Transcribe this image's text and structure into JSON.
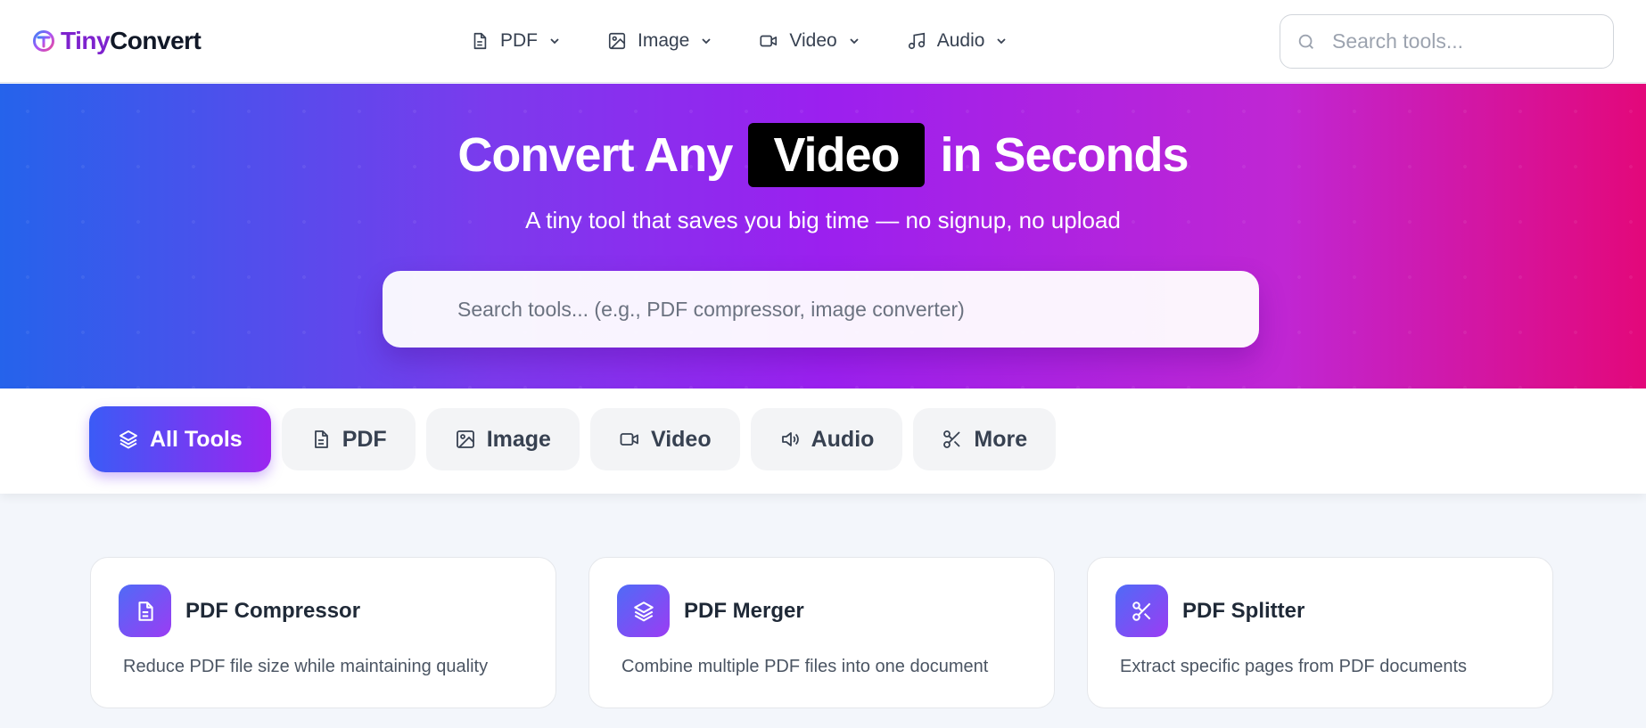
{
  "brand": {
    "name_part1": "Tiny",
    "name_part2": "Convert"
  },
  "nav": {
    "items": [
      {
        "label": "PDF",
        "icon": "file-icon"
      },
      {
        "label": "Image",
        "icon": "image-icon"
      },
      {
        "label": "Video",
        "icon": "video-icon"
      },
      {
        "label": "Audio",
        "icon": "music-icon"
      }
    ]
  },
  "header_search": {
    "placeholder": "Search tools..."
  },
  "hero": {
    "title_before": "Convert Any",
    "title_highlight": "Video",
    "title_after": "in Seconds",
    "subtitle": "A tiny tool that saves you big time — no signup, no upload",
    "search_placeholder": "Search tools... (e.g., PDF compressor, image converter)"
  },
  "filters": {
    "items": [
      {
        "label": "All Tools",
        "icon": "layers-icon",
        "active": true
      },
      {
        "label": "PDF",
        "icon": "file-icon"
      },
      {
        "label": "Image",
        "icon": "image-icon"
      },
      {
        "label": "Video",
        "icon": "video-icon"
      },
      {
        "label": "Audio",
        "icon": "speaker-icon"
      },
      {
        "label": "More",
        "icon": "scissors-icon"
      }
    ]
  },
  "cards": [
    {
      "title": "PDF Compressor",
      "description": "Reduce PDF file size while maintaining quality",
      "icon": "file-icon"
    },
    {
      "title": "PDF Merger",
      "description": "Combine multiple PDF files into one document",
      "icon": "layers-icon"
    },
    {
      "title": "PDF Splitter",
      "description": "Extract specific pages from PDF documents",
      "icon": "scissors-icon"
    }
  ],
  "colors": {
    "brand_purple": "#7e22ce",
    "gradient_start": "#2563eb",
    "gradient_mid": "#9b20ef",
    "gradient_end": "#e3087a"
  }
}
